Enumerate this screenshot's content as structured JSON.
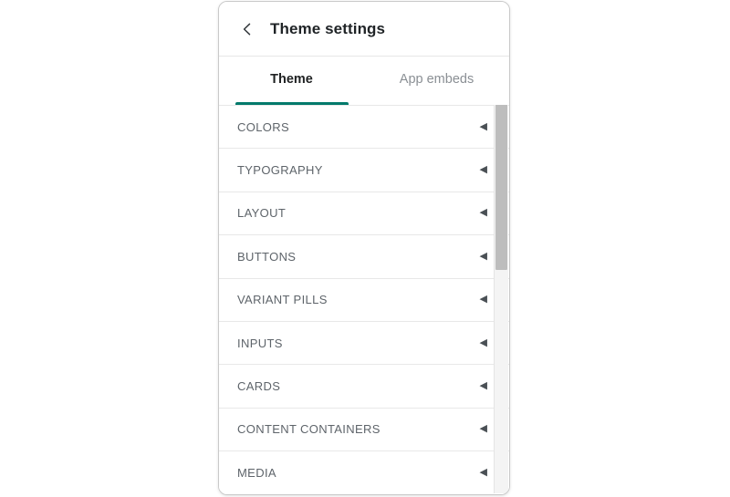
{
  "panel": {
    "header": {
      "back_icon": "chevron-left-icon",
      "title": "Theme settings"
    },
    "tabs": [
      {
        "label": "Theme",
        "active": true
      },
      {
        "label": "App embeds",
        "active": false
      }
    ],
    "sections": [
      {
        "label": "COLORS",
        "arrow": "◀"
      },
      {
        "label": "TYPOGRAPHY",
        "arrow": "◀"
      },
      {
        "label": "LAYOUT",
        "arrow": "◀"
      },
      {
        "label": "BUTTONS",
        "arrow": "◀"
      },
      {
        "label": "VARIANT PILLS",
        "arrow": "◀"
      },
      {
        "label": "INPUTS",
        "arrow": "◀"
      },
      {
        "label": "CARDS",
        "arrow": "◀"
      },
      {
        "label": "CONTENT CONTAINERS",
        "arrow": "◀"
      },
      {
        "label": "MEDIA",
        "arrow": "◀"
      }
    ],
    "scrollbar": {
      "up_arrow_icon": "scroll-up-arrow-icon",
      "thumb_name": "scrollbar-thumb"
    }
  },
  "colors": {
    "accent": "#00796b",
    "title_text": "#1f2326",
    "row_text": "#5e646a",
    "inactive_tab_text": "#8a8f94",
    "panel_border": "#c9c9c9",
    "divider": "#e8e8e8",
    "scrollbar_track": "#f4f4f4",
    "scrollbar_thumb": "#bdbdbd",
    "page_background": "#ffffff"
  }
}
